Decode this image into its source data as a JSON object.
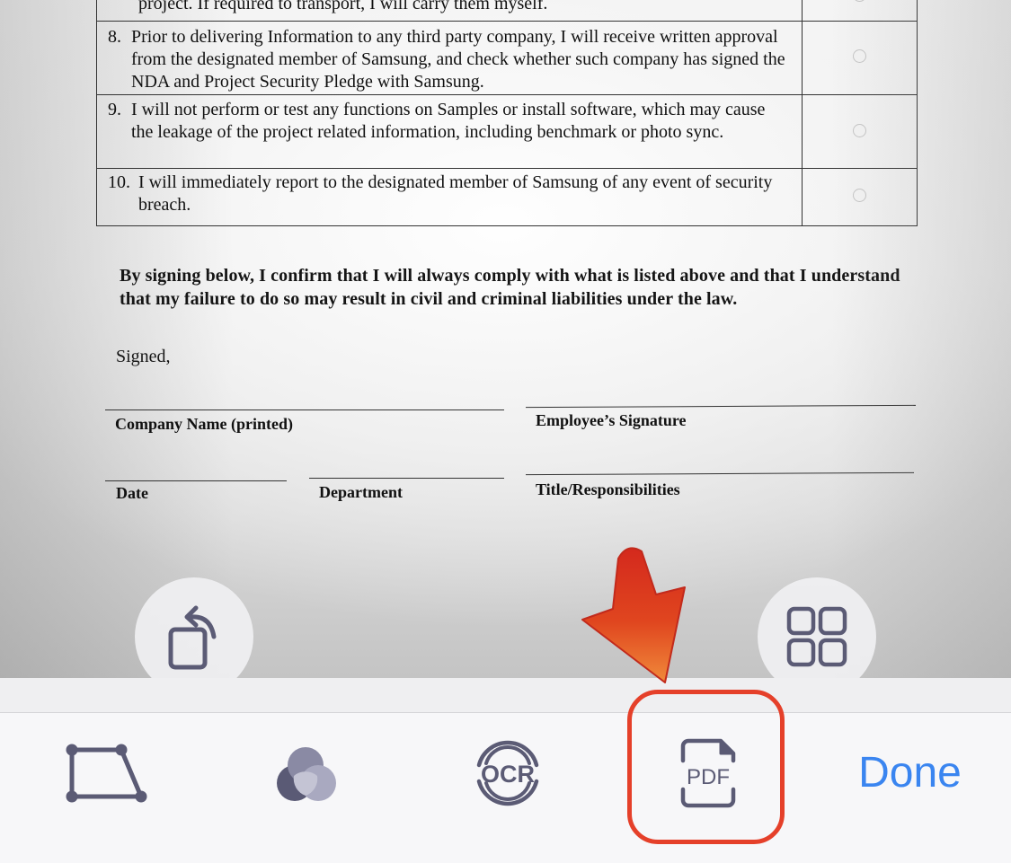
{
  "document": {
    "table_rows": [
      {
        "num": "",
        "text": "project. If required to transport, I will carry them myself."
      },
      {
        "num": "8.",
        "text": "Prior to delivering Information to any third party company, I will receive written approval from the designated member of Samsung, and check whether such company has signed the NDA and Project Security Pledge with Samsung."
      },
      {
        "num": "9.",
        "text": "I will not perform or test any functions on Samples or install software, which may cause the leakage of the project related information, including benchmark or photo sync."
      },
      {
        "num": "10.",
        "text": "I will immediately report to the designated member of Samsung of any event of security breach."
      }
    ],
    "confirm_statement": "By signing below, I confirm that I will always comply with what is listed above and that I understand that my failure to do so may result in civil and criminal liabilities under the law.",
    "signed_label": "Signed,",
    "signature_fields": {
      "company_name": "Company Name (printed)",
      "employee_signature": "Employee’s Signature",
      "date": "Date",
      "department": "Department",
      "title": "Title/Responsibilities"
    }
  },
  "floating_buttons": {
    "rotate": "rotate-icon",
    "grid": "grid-icon"
  },
  "toolbar": {
    "crop_icon": "crop-quad-icon",
    "filter_icon": "color-filter-icon",
    "ocr_icon": "ocr-icon",
    "ocr_text": "OCR",
    "pdf_icon": "pdf-icon",
    "pdf_text": "PDF",
    "done_label": "Done"
  },
  "colors": {
    "accent": "#3a85f0",
    "icon": "#5b5b75",
    "highlight": "#e5402a",
    "arrow_top": "#d4291d",
    "arrow_bottom": "#f08a3a"
  }
}
